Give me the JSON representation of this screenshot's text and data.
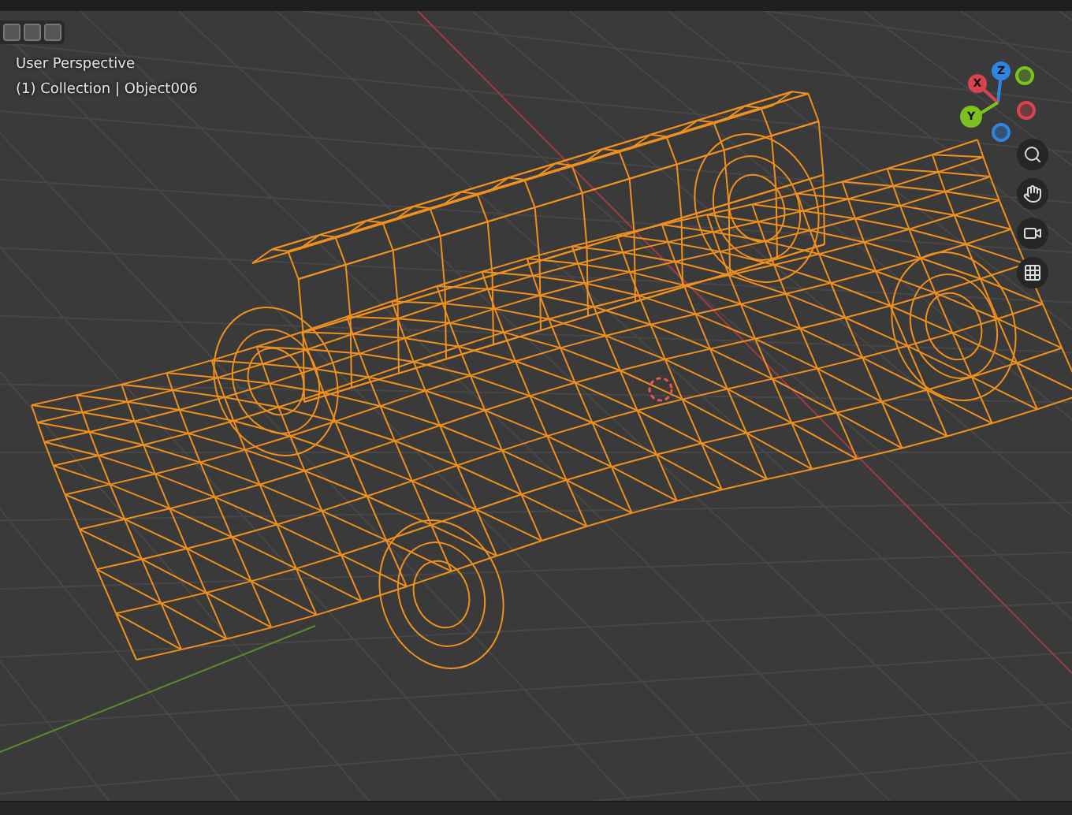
{
  "viewport": {
    "view_label": "User Perspective",
    "object_label": "(1) Collection | Object006"
  },
  "gizmo": {
    "axes": [
      {
        "label": "Z",
        "color": "#2f86e0"
      },
      {
        "label": "X",
        "color": "#d9434f"
      },
      {
        "label": "Y",
        "color": "#7cc21f"
      }
    ]
  }
}
